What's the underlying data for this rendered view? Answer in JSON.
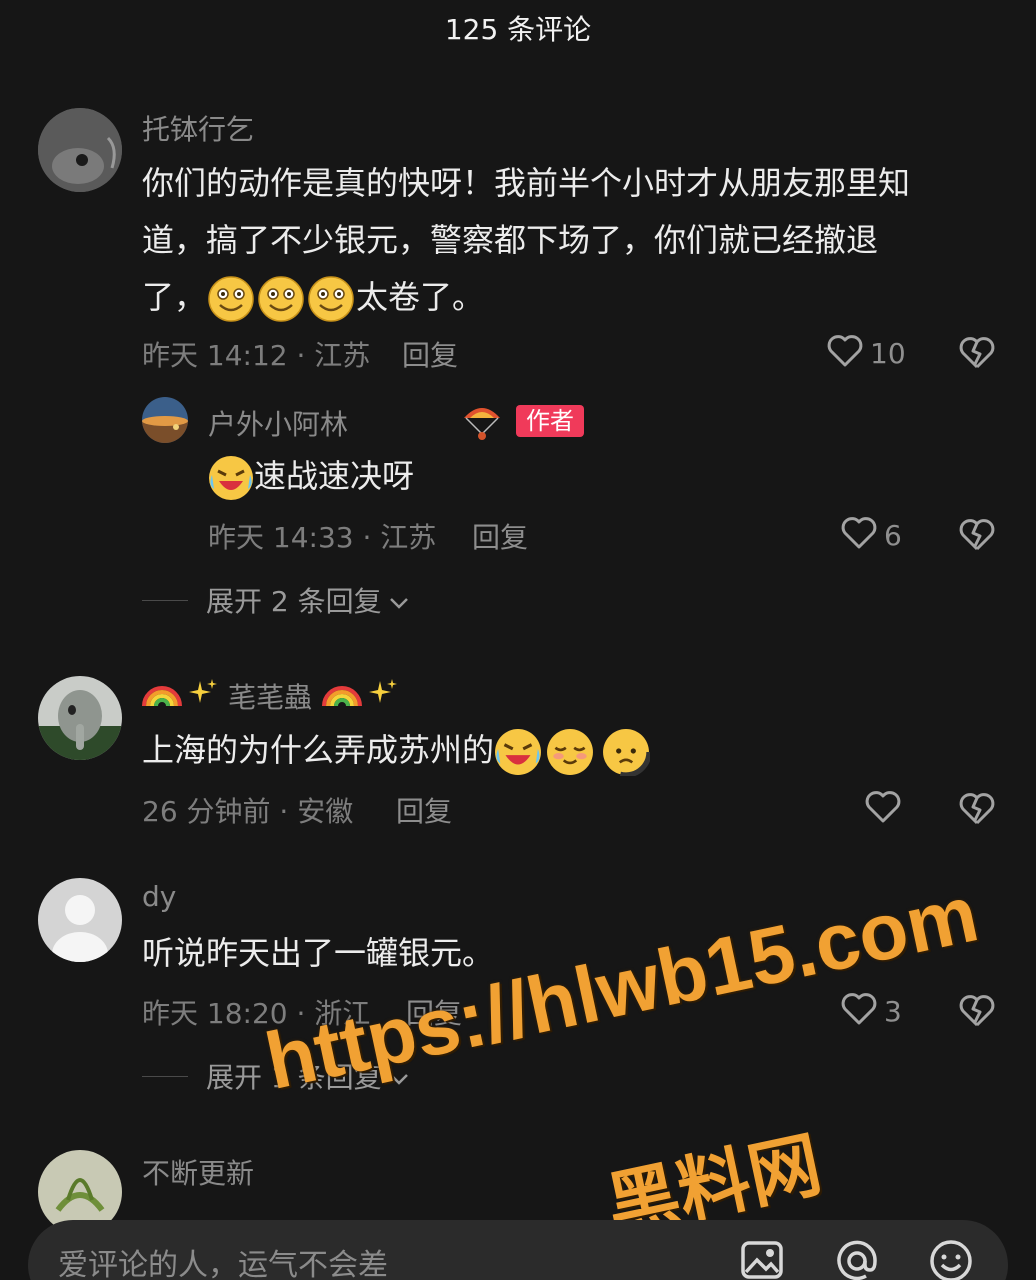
{
  "header": {
    "title": "125 条评论"
  },
  "comments": [
    {
      "username": "托钵行乞",
      "text_line1": "你们的动作是真的快呀！我前半个小时才从朋友那里知",
      "text_line2": "道，搞了不少银元，警察都下场了，你们就已经撤退",
      "text_line3_a": "了，",
      "text_line3_b": "太卷了。",
      "meta": "昨天 14:12 · 江苏",
      "reply_label": "回复",
      "likes": "10",
      "emojis": [
        "grin-emoji",
        "grin-emoji",
        "grin-emoji"
      ]
    },
    {
      "username": "🌈✨ 芼芼蟲 🌈✨",
      "username_icons": [
        "rainbow",
        "sparkles",
        "rainbow",
        "sparkles"
      ],
      "username_text": "芼芼蟲",
      "text": "上海的为什么弄成苏州的",
      "meta": "26 分钟前 · 安徽",
      "reply_label": "回复",
      "likes": "",
      "emojis": [
        "laugh-cry-emoji",
        "relieved-emoji",
        "sad-emoji"
      ]
    },
    {
      "username": "dy",
      "text": "听说昨天出了一罐银元。",
      "meta": "昨天 18:20 · 浙江",
      "reply_label": "回复",
      "likes": "3",
      "expand_label": "展开 1 条回复"
    },
    {
      "username": "不断更新"
    }
  ],
  "reply": {
    "username": "户外小阿林",
    "author_badge": "作者",
    "text": "速战速决呀",
    "meta": "昨天 14:33 · 江苏",
    "reply_label": "回复",
    "likes": "6",
    "expand_label": "展开 2 条回复"
  },
  "watermark": {
    "url": "https://hlwb15.com",
    "name": "黑料网"
  },
  "input": {
    "placeholder": "爱评论的人，运气不会差"
  },
  "colors": {
    "background": "#161616",
    "author_badge": "#f03a5a",
    "watermark": "#f1a133"
  }
}
